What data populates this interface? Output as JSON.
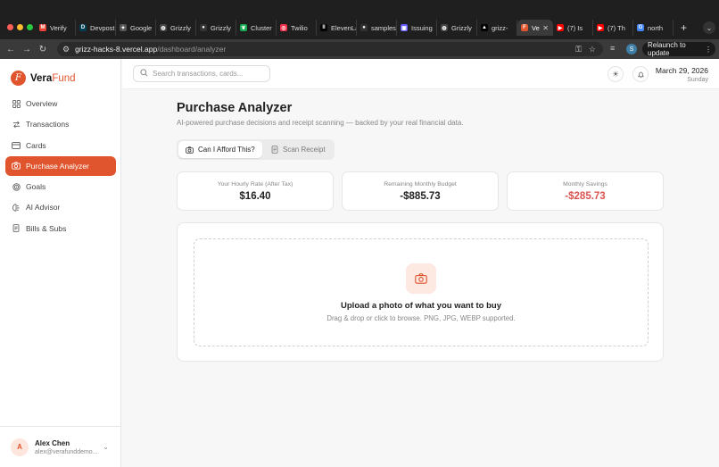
{
  "browser": {
    "tabs": [
      {
        "label": "Verify",
        "icon": "gmail-icon",
        "color": "#ea4335",
        "glyph": "M"
      },
      {
        "label": "Devpost",
        "icon": "devpost-icon",
        "color": "#003e54",
        "glyph": "D"
      },
      {
        "label": "Google",
        "icon": "gemini-icon",
        "color": "#555555",
        "glyph": "✦"
      },
      {
        "label": "Grizzly",
        "icon": "grizz-icon",
        "color": "#444444",
        "glyph": "◍"
      },
      {
        "label": "Grizzly",
        "icon": "github-icon",
        "color": "#333333",
        "glyph": "●"
      },
      {
        "label": "Cluster",
        "icon": "mongodb-icon",
        "color": "#13aa52",
        "glyph": "❦"
      },
      {
        "label": "Twilio",
        "icon": "twilio-icon",
        "color": "#f22f46",
        "glyph": "◎"
      },
      {
        "label": "ElevenLabs",
        "icon": "elevenlabs-icon",
        "color": "#000000",
        "glyph": "II"
      },
      {
        "label": "samples",
        "icon": "github-icon",
        "color": "#333333",
        "glyph": "●"
      },
      {
        "label": "Issuing",
        "icon": "stripe-icon",
        "color": "#635bff",
        "glyph": "▣"
      },
      {
        "label": "Grizzly",
        "icon": "grizz-icon",
        "color": "#444444",
        "glyph": "◍"
      },
      {
        "label": "grizz-",
        "icon": "vercel-icon",
        "color": "#000000",
        "glyph": "▲"
      },
      {
        "label": "Ve",
        "icon": "verafund-icon",
        "color": "#e0552e",
        "glyph": "F",
        "active": true
      },
      {
        "label": "(7) Is",
        "icon": "youtube-icon",
        "color": "#ff0000",
        "glyph": "▶"
      },
      {
        "label": "(7) Th",
        "icon": "youtube-icon",
        "color": "#ff0000",
        "glyph": "▶"
      },
      {
        "label": "north",
        "icon": "google-icon",
        "color": "#4285f4",
        "glyph": "G"
      }
    ],
    "new_tab": "+",
    "url_host": "grizz-hacks-8.vercel.app",
    "url_path": "/dashboard/analyzer",
    "profile_initial": "S",
    "relaunch_label": "Relaunch to update"
  },
  "sidebar": {
    "brand_prefix": "Vera",
    "brand_suffix": "Fund",
    "logo_letter": "F",
    "items": [
      {
        "label": "Overview",
        "icon": "grid-icon"
      },
      {
        "label": "Transactions",
        "icon": "arrows-icon"
      },
      {
        "label": "Cards",
        "icon": "card-icon"
      },
      {
        "label": "Purchase Analyzer",
        "icon": "camera-icon",
        "active": true
      },
      {
        "label": "Goals",
        "icon": "target-icon"
      },
      {
        "label": "AI Advisor",
        "icon": "brain-icon"
      },
      {
        "label": "Bills & Subs",
        "icon": "receipt-icon"
      }
    ],
    "user": {
      "initial": "A",
      "name": "Alex Chen",
      "email": "alex@verafunddemo..."
    }
  },
  "topbar": {
    "search_placeholder": "Search transactions, cards...",
    "date": "March 29, 2026",
    "weekday": "Sunday"
  },
  "main": {
    "title": "Purchase Analyzer",
    "subtitle": "AI-powered purchase decisions and receipt scanning — backed by your real financial data.",
    "tabs": [
      {
        "label": "Can I Afford This?",
        "active": true
      },
      {
        "label": "Scan Receipt",
        "active": false
      }
    ],
    "stats": [
      {
        "label": "Your Hourly Rate (After Tax)",
        "value": "$16.40"
      },
      {
        "label": "Remaining Monthly Budget",
        "value": "-$885.73"
      },
      {
        "label": "Monthly Savings",
        "value": "-$285.73"
      }
    ],
    "upload": {
      "title": "Upload a photo of what you want to buy",
      "hint": "Drag & drop or click to browse. PNG, JPG, WEBP supported."
    }
  },
  "colors": {
    "accent": "#e0552e",
    "negative": "#d9534f"
  }
}
